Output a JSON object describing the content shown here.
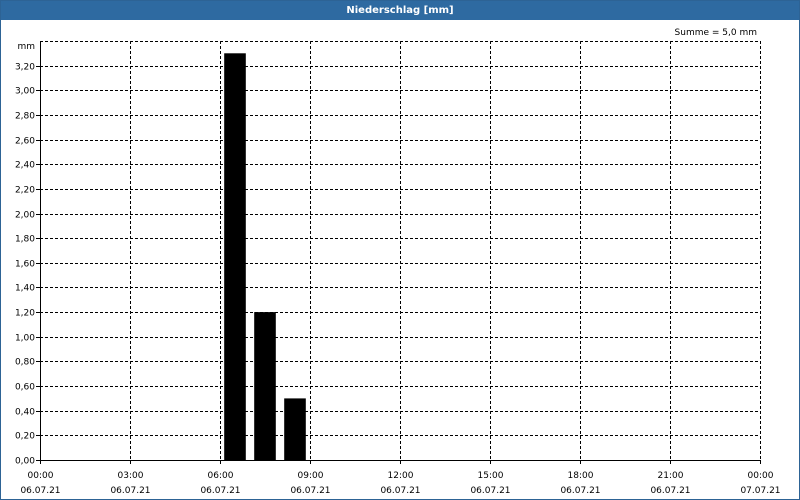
{
  "window": {
    "title": "Niederschlag [mm]"
  },
  "chart_data": {
    "type": "bar",
    "title": "Niederschlag [mm]",
    "annotation": "Summe = 5,0 mm",
    "ylabel": "mm",
    "ylim": [
      0,
      3.4
    ],
    "yticks": [
      "0,00",
      "0,20",
      "0,40",
      "0,60",
      "0,80",
      "1,00",
      "1,20",
      "1,40",
      "1,60",
      "1,80",
      "2,00",
      "2,20",
      "2,40",
      "2,60",
      "2,80",
      "3,00",
      "3,20"
    ],
    "xlim_hours": [
      0,
      24
    ],
    "xticks": [
      {
        "time": "00:00",
        "date": "06.07.21"
      },
      {
        "time": "03:00",
        "date": "06.07.21"
      },
      {
        "time": "06:00",
        "date": "06.07.21"
      },
      {
        "time": "09:00",
        "date": "06.07.21"
      },
      {
        "time": "12:00",
        "date": "06.07.21"
      },
      {
        "time": "15:00",
        "date": "06.07.21"
      },
      {
        "time": "18:00",
        "date": "06.07.21"
      },
      {
        "time": "21:00",
        "date": "06.07.21"
      },
      {
        "time": "00:00",
        "date": "07.07.21"
      }
    ],
    "bars": [
      {
        "start": "06:00",
        "end": "07:00",
        "value": 3.3
      },
      {
        "start": "07:00",
        "end": "08:00",
        "value": 1.2
      },
      {
        "start": "08:00",
        "end": "09:00",
        "value": 0.5
      }
    ],
    "grid": true,
    "colors": {
      "bar": "#000000",
      "title_bar": "#2e6aa1",
      "grid": "#000000"
    }
  }
}
